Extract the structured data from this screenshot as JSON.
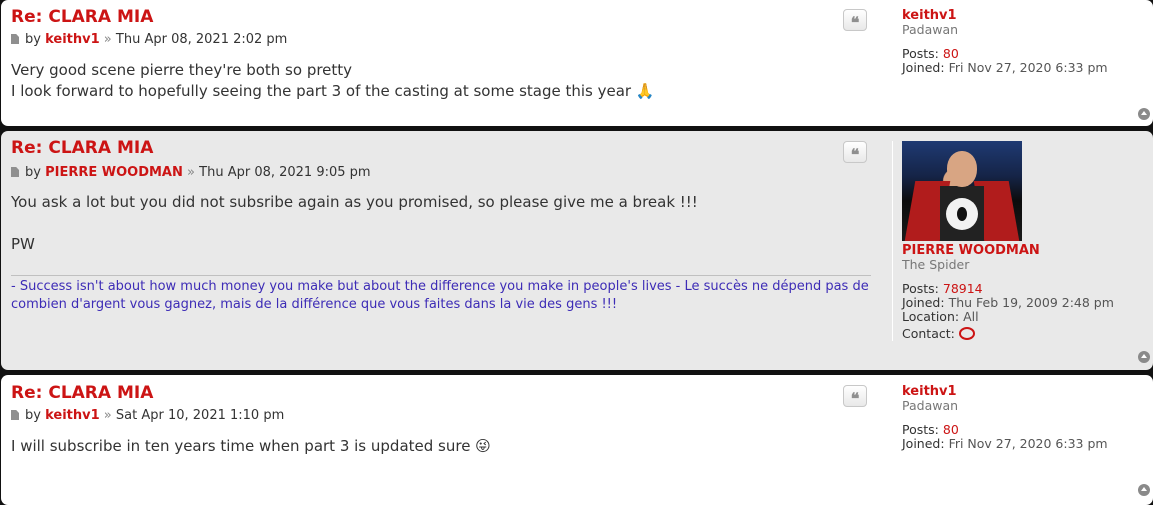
{
  "posts": [
    {
      "title": "Re: CLARA MIA",
      "by": "by",
      "author": "keithv1",
      "sep": "»",
      "date": "Thu Apr 08, 2021 2:02 pm",
      "lines": [
        "Very good scene pierre they're both so pretty",
        "I look forward to hopefully seeing the part 3 of the casting at some stage this year 🙏"
      ],
      "profile": {
        "username": "keithv1",
        "rank": "Padawan",
        "posts_label": "Posts:",
        "posts_value": "80",
        "joined_label": "Joined:",
        "joined_value": "Fri Nov 27, 2020 6:33 pm"
      }
    },
    {
      "title": "Re: CLARA MIA",
      "by": "by",
      "author": "PIERRE WOODMAN",
      "sep": "»",
      "date": "Thu Apr 08, 2021 9:05 pm",
      "lines": [
        "You ask a lot but you did not subsribe again as you promised, so please give me a break !!!",
        "PW"
      ],
      "signature": "- Success isn't about how much money you make but about the difference you make in people's lives - Le succès ne dépend pas de combien d'argent vous gagnez, mais de la différence que vous faites dans la vie des gens !!!",
      "profile": {
        "username": "PIERRE WOODMAN",
        "rank": "The Spider",
        "posts_label": "Posts:",
        "posts_value": "78914",
        "joined_label": "Joined:",
        "joined_value": "Thu Feb 19, 2009 2:48 pm",
        "location_label": "Location:",
        "location_value": "All",
        "contact_label": "Contact:"
      }
    },
    {
      "title": "Re: CLARA MIA",
      "by": "by",
      "author": "keithv1",
      "sep": "»",
      "date": "Sat Apr 10, 2021 1:10 pm",
      "lines": [
        "I will subscribe in ten years time when part 3 is updated sure 😜"
      ],
      "profile": {
        "username": "keithv1",
        "rank": "Padawan",
        "posts_label": "Posts:",
        "posts_value": "80",
        "joined_label": "Joined:",
        "joined_value": "Fri Nov 27, 2020 6:33 pm"
      }
    }
  ],
  "quote_glyph": "❝",
  "icons": {
    "post": "post-icon",
    "quote": "quote-icon",
    "top": "back-to-top-icon",
    "contact": "contact-chat-icon"
  },
  "colors": {
    "accent": "#cc1414",
    "signature": "#3d2cb6",
    "post_bg_1": "#ffffff",
    "post_bg_2": "#e9e9e9"
  }
}
